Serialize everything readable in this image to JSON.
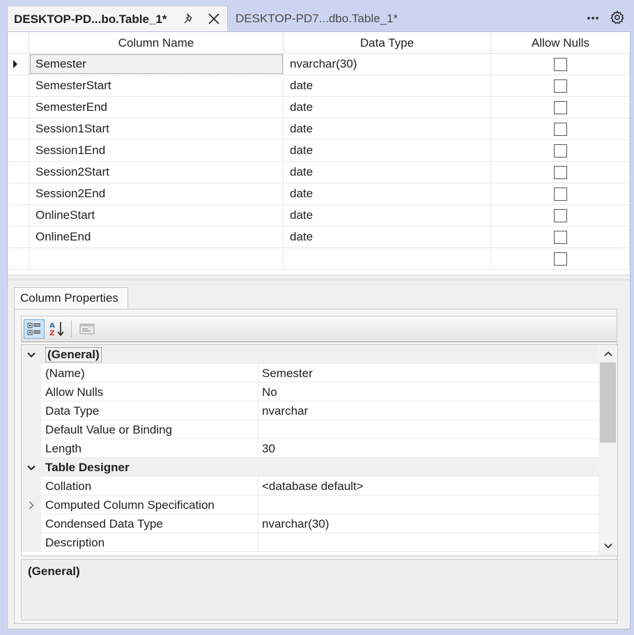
{
  "tabs": [
    {
      "title": "DESKTOP-PD...bo.Table_1*",
      "active": true
    },
    {
      "title": "DESKTOP-PD7...dbo.Table_1*",
      "active": false
    }
  ],
  "grid": {
    "headers": [
      "Column Name",
      "Data Type",
      "Allow Nulls"
    ],
    "rows": [
      {
        "name": "Semester",
        "type": "nvarchar(30)",
        "allow_nulls": false
      },
      {
        "name": "SemesterStart",
        "type": "date",
        "allow_nulls": false
      },
      {
        "name": "SemesterEnd",
        "type": "date",
        "allow_nulls": false
      },
      {
        "name": "Session1Start",
        "type": "date",
        "allow_nulls": false
      },
      {
        "name": "Session1End",
        "type": "date",
        "allow_nulls": false
      },
      {
        "name": "Session2Start",
        "type": "date",
        "allow_nulls": false
      },
      {
        "name": "Session2End",
        "type": "date",
        "allow_nulls": false
      },
      {
        "name": "OnlineStart",
        "type": "date",
        "allow_nulls": false
      },
      {
        "name": "OnlineEnd",
        "type": "date",
        "allow_nulls": false
      },
      {
        "name": "",
        "type": "",
        "allow_nulls": false
      }
    ]
  },
  "column_properties": {
    "tab_label": "Column Properties",
    "toolbar": {
      "categorized_icon": "categorized-icon",
      "alphabetical_icon": "sort-az-icon",
      "property_pages_icon": "property-pages-icon"
    },
    "groups": [
      {
        "category": "(General)",
        "expanded": true,
        "items": [
          {
            "name": "(Name)",
            "value": "Semester"
          },
          {
            "name": "Allow Nulls",
            "value": "No"
          },
          {
            "name": "Data Type",
            "value": "nvarchar"
          },
          {
            "name": "Default Value or Binding",
            "value": ""
          },
          {
            "name": "Length",
            "value": "30"
          }
        ]
      },
      {
        "category": "Table Designer",
        "expanded": true,
        "items": [
          {
            "name": "Collation",
            "value": "<database default>",
            "expandable": false
          },
          {
            "name": "Computed Column Specification",
            "value": "",
            "expandable": true
          },
          {
            "name": "Condensed Data Type",
            "value": "nvarchar(30)",
            "expandable": false
          },
          {
            "name": "Description",
            "value": "",
            "expandable": false
          }
        ]
      }
    ],
    "description_title": "(General)"
  },
  "colors": {
    "chrome": "#ccd5f0",
    "selected_toolbar_button": "#cfe3f7"
  }
}
